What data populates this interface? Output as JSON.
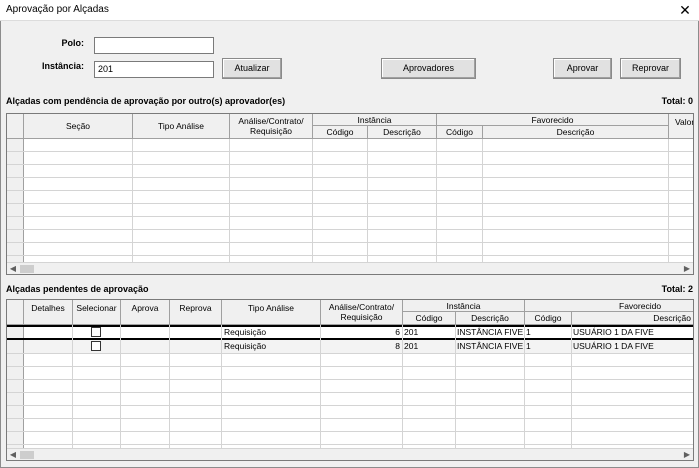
{
  "window": {
    "title": "Aprovação por Alçadas",
    "close": "✕"
  },
  "filters": {
    "polo_label": "Polo:",
    "polo_value": "",
    "instancia_label": "Instância:",
    "instancia_value": "201"
  },
  "buttons": {
    "atualizar": "Atualizar",
    "aprovadores": "Aprovadores",
    "aprovar": "Aprovar",
    "reprovar": "Reprovar"
  },
  "section1": {
    "label": "Alçadas com pendência de aprovação por outro(s) aprovador(es)",
    "total": "Total: 0",
    "headers": {
      "secao": "Seção",
      "tipo_analise": "Tipo Análise",
      "analise": "Análise/Contrato/\nRequisição",
      "instancia": "Instância",
      "inst_codigo": "Código",
      "inst_descricao": "Descrição",
      "favorecido": "Favorecido",
      "fav_codigo": "Código",
      "fav_descricao": "Descrição",
      "valor": "Valor"
    }
  },
  "section2": {
    "label": "Alçadas pendentes de aprovação",
    "total": "Total: 2",
    "headers": {
      "detalhes": "Detalhes",
      "selecionar": "Selecionar",
      "aprova": "Aprova",
      "reprova": "Reprova",
      "tipo_analise": "Tipo Análise",
      "analise": "Análise/Contrato/\nRequisição",
      "instancia": "Instância",
      "inst_codigo": "Código",
      "inst_descricao": "Descrição",
      "favorecido": "Favorecido",
      "fav_codigo": "Código",
      "fav_descricao": "Descrição"
    },
    "rows": [
      {
        "tipo": "Requisição",
        "analise": "6",
        "inst_codigo": "201",
        "inst_descricao": "INSTÂNCIA FIVE",
        "fav_codigo": "1",
        "fav_descricao": "USUÁRIO 1 DA FIVE"
      },
      {
        "tipo": "Requisição",
        "analise": "8",
        "inst_codigo": "201",
        "inst_descricao": "INSTÂNCIA FIVE",
        "fav_codigo": "1",
        "fav_descricao": "USUÁRIO 1 DA FIVE"
      }
    ]
  },
  "icons": {
    "scroll_left": "arrow-left-icon",
    "scroll_right": "arrow-right-icon",
    "close": "close-icon"
  }
}
